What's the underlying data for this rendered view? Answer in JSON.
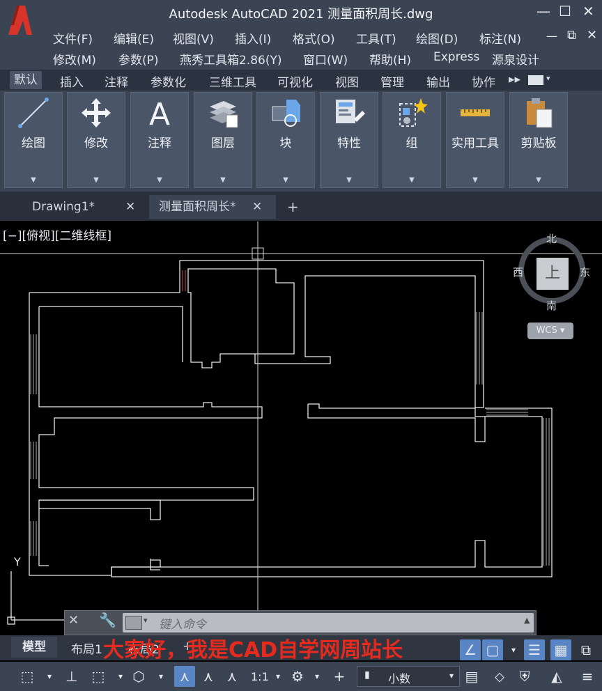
{
  "app": {
    "title": "Autodesk AutoCAD 2021    测量面积周长.dwg",
    "window_controls": [
      "—",
      "☐",
      "✕"
    ]
  },
  "menu_row1": [
    "文件(F)",
    "编辑(E)",
    "视图(V)",
    "插入(I)",
    "格式(O)",
    "工具(T)",
    "绘图(D)",
    "标注(N)"
  ],
  "menu_row2": [
    "修改(M)",
    "参数(P)",
    "燕秀工具箱2.86(Y)",
    "窗口(W)",
    "帮助(H)",
    "Express",
    "源泉设计"
  ],
  "ribbon_tabs": [
    "默认",
    "插入",
    "注释",
    "参数化",
    "三维工具",
    "可视化",
    "视图",
    "管理",
    "输出",
    "协作"
  ],
  "ribbon_panels": [
    "绘图",
    "修改",
    "注释",
    "图层",
    "块",
    "特性",
    "组",
    "实用工具",
    "剪贴板"
  ],
  "doc_tabs": {
    "tab1": "Drawing1*",
    "tab2": "测量面积周长*",
    "close": "✕",
    "add": "+"
  },
  "viewport": {
    "label": "[−][俯视][二维线框]",
    "viewcube_face": "上",
    "compass": {
      "n": "北",
      "s": "南",
      "e": "东",
      "w": "西"
    },
    "ucs_button": "WCS ▾",
    "ucs_y": "Y"
  },
  "command": {
    "placeholder": "键入命令"
  },
  "layout_tabs": [
    "模型",
    "布局1",
    "布局2"
  ],
  "subtitle": "大家好，我是CAD自学网周站长",
  "status": {
    "scale": "1:1",
    "units": "小数"
  },
  "colors": {
    "accent": "#5a85c5",
    "subtitle": "#e62b1e",
    "logo": "#d9342a"
  }
}
